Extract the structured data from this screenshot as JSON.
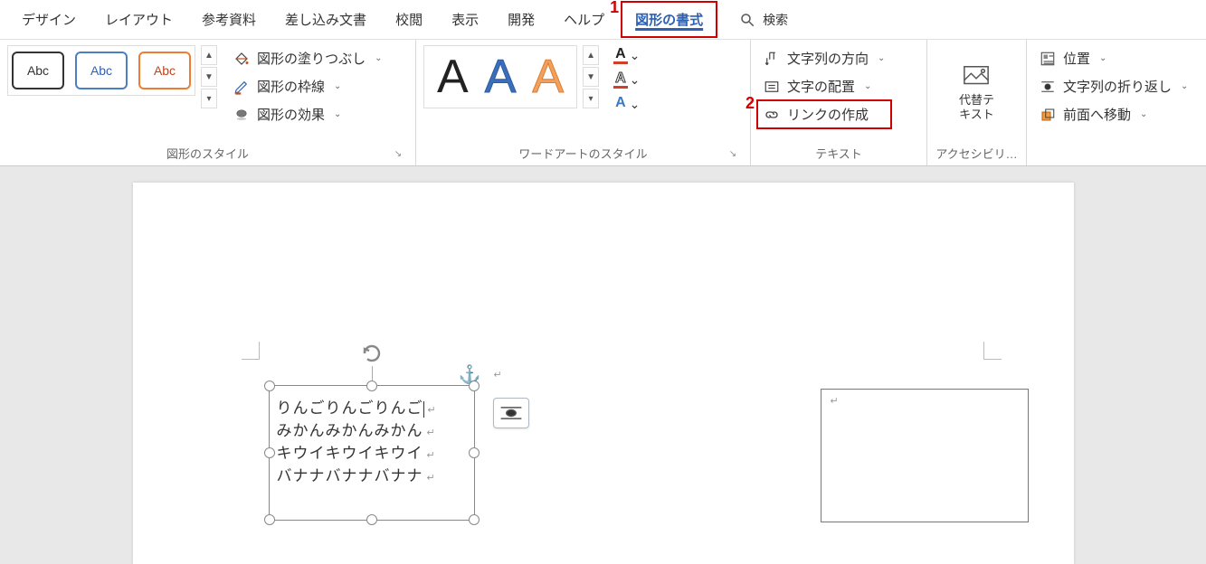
{
  "tabs": {
    "design": "デザイン",
    "layout": "レイアウト",
    "references": "参考資料",
    "mailings": "差し込み文書",
    "review": "校閲",
    "view": "表示",
    "developer": "開発",
    "help": "ヘルプ",
    "shape_format": "図形の書式"
  },
  "search": {
    "placeholder": "検索"
  },
  "callouts": {
    "one": "1",
    "two": "2"
  },
  "shape_styles": {
    "group_label": "図形のスタイル",
    "sample_text": "Abc",
    "fill": "図形の塗りつぶし",
    "outline": "図形の枠線",
    "effects": "図形の効果"
  },
  "wordart": {
    "group_label": "ワードアートのスタイル",
    "letter": "A"
  },
  "text": {
    "group_label": "テキスト",
    "direction": "文字列の方向",
    "align": "文字の配置",
    "create_link": "リンクの作成"
  },
  "accessibility": {
    "group_label": "アクセシビリ…",
    "alt_text_l1": "代替テ",
    "alt_text_l2": "キスト"
  },
  "arrange": {
    "position": "位置",
    "wrap": "文字列の折り返し",
    "bring_front": "前面へ移動"
  },
  "document": {
    "lines": [
      "りんごりんごりんご",
      "みかんみかんみかん",
      "キウイキウイキウイ",
      "バナナバナナバナナ"
    ]
  }
}
